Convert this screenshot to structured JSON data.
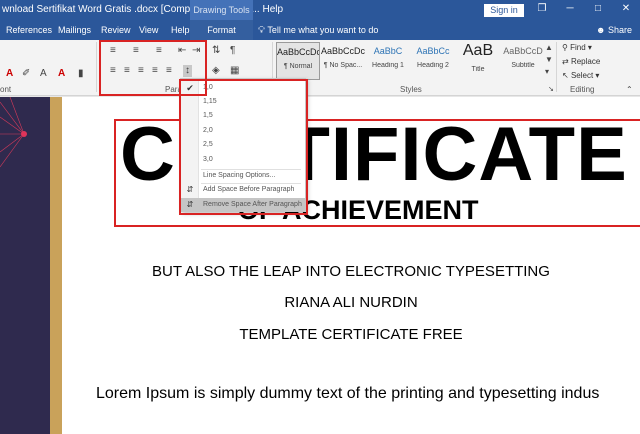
{
  "titlebar": {
    "doc_title": "wnload Sertifikat Word Gratis .docx [Compatibility Mode]... Help",
    "drawing_tools": "Drawing Tools",
    "sign_in": "Sign in",
    "restore_glyph": "❐",
    "minimize_glyph": "─",
    "maximize_glyph": "□",
    "close_glyph": "✕"
  },
  "tabs": {
    "references": "References",
    "mailings": "Mailings",
    "review": "Review",
    "view": "View",
    "help": "Help",
    "format": "Format",
    "tell_me": "Tell me what you want to do",
    "share": "Share"
  },
  "ribbon": {
    "paragraph_label": "Parag",
    "styles_label": "Styles",
    "editing_label": "Editing",
    "font_tail_label": "ont",
    "styles": [
      {
        "preview": "AaBbCcDc",
        "name": "¶ Normal"
      },
      {
        "preview": "AaBbCcDc",
        "name": "¶ No Spac..."
      },
      {
        "preview": "AaBbC",
        "name": "Heading 1"
      },
      {
        "preview": "AaBbCc",
        "name": "Heading 2"
      },
      {
        "preview": "AaB",
        "name": "Title"
      },
      {
        "preview": "AaBbCcD",
        "name": "Subtitle"
      }
    ],
    "editing": {
      "find": "Find",
      "replace": "Replace",
      "select": "Select"
    }
  },
  "line_spacing_menu": {
    "options": [
      "1,0",
      "1,15",
      "1,5",
      "2,0",
      "2,5",
      "3,0"
    ],
    "selected": "1,0",
    "line_spacing_options": "Line Spacing Options...",
    "add_space_before": "Add Space Before Paragraph",
    "remove_space_after": "Remove Space After Paragraph"
  },
  "document": {
    "title": "CERTIFICATE",
    "subtitle": "OF ACHIEVEMENT",
    "line1": "BUT ALSO THE LEAP INTO ELECTRONIC TYPESETTING",
    "name": "RIANA ALI NURDIN",
    "line3": "TEMPLATE CERTIFICATE FREE",
    "lorem": "Lorem Ipsum is simply dummy text of the printing and typesetting indus"
  },
  "colors": {
    "title_bar": "#2b579a",
    "highlight_box": "#d92323",
    "panel_navy": "#2f2a4e",
    "panel_gold": "#c9a25a"
  }
}
